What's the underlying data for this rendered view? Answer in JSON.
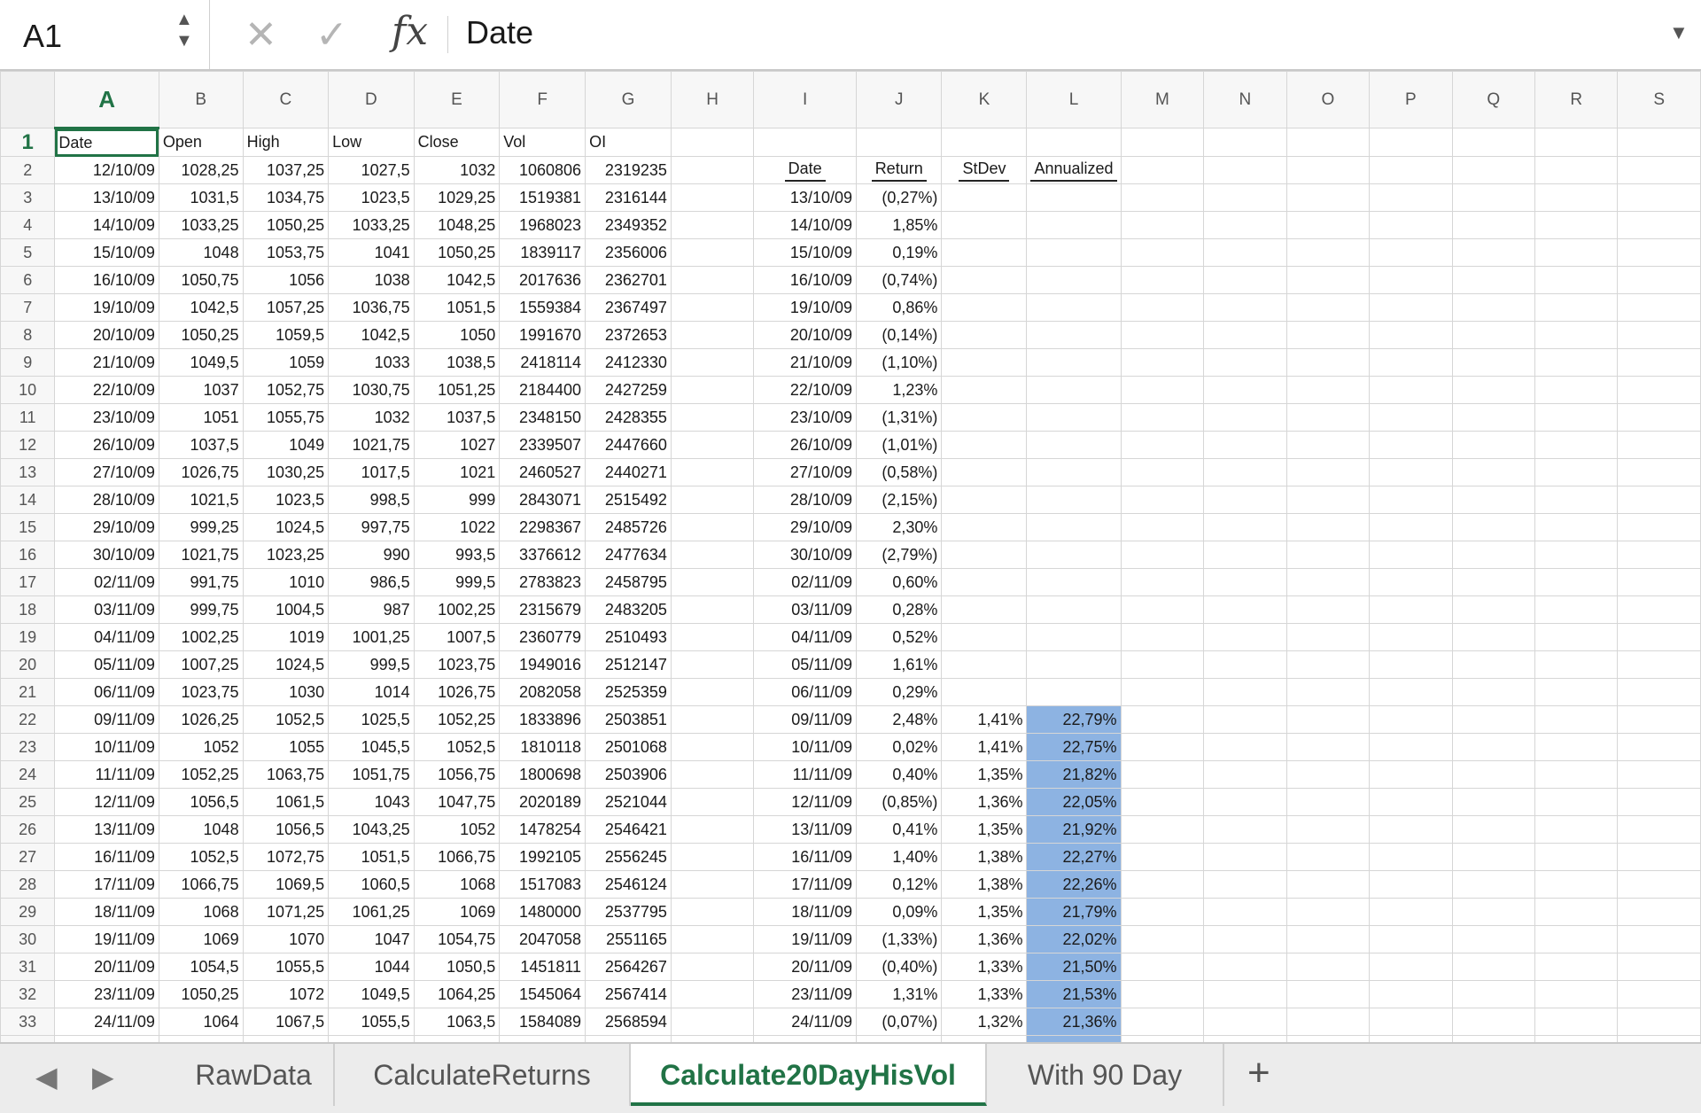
{
  "formula_bar": {
    "name_box": "A1",
    "formula": "Date",
    "cancel_icon": "✕",
    "enter_icon": "✓",
    "fx_label": "fx"
  },
  "columns": [
    "A",
    "B",
    "C",
    "D",
    "E",
    "F",
    "G",
    "H",
    "I",
    "J",
    "K",
    "L",
    "M",
    "N",
    "O",
    "P",
    "Q",
    "R",
    "S"
  ],
  "headers_row1": [
    "Date",
    "Open",
    "High",
    "Low",
    "Close",
    "Vol",
    "OI"
  ],
  "headers_row2": [
    "Date",
    "Return",
    "StDev",
    "Annualized"
  ],
  "rows": [
    {
      "n": "2",
      "d": [
        "12/10/09",
        "1028,25",
        "1037,25",
        "1027,5",
        "1032",
        "1060806",
        "2319235"
      ],
      "r": [
        "",
        "",
        "",
        ""
      ]
    },
    {
      "n": "3",
      "d": [
        "13/10/09",
        "1031,5",
        "1034,75",
        "1023,5",
        "1029,25",
        "1519381",
        "2316144"
      ],
      "r": [
        "13/10/09",
        "(0,27%)",
        "",
        ""
      ]
    },
    {
      "n": "4",
      "d": [
        "14/10/09",
        "1033,25",
        "1050,25",
        "1033,25",
        "1048,25",
        "1968023",
        "2349352"
      ],
      "r": [
        "14/10/09",
        "1,85%",
        "",
        ""
      ]
    },
    {
      "n": "5",
      "d": [
        "15/10/09",
        "1048",
        "1053,75",
        "1041",
        "1050,25",
        "1839117",
        "2356006"
      ],
      "r": [
        "15/10/09",
        "0,19%",
        "",
        ""
      ]
    },
    {
      "n": "6",
      "d": [
        "16/10/09",
        "1050,75",
        "1056",
        "1038",
        "1042,5",
        "2017636",
        "2362701"
      ],
      "r": [
        "16/10/09",
        "(0,74%)",
        "",
        ""
      ]
    },
    {
      "n": "7",
      "d": [
        "19/10/09",
        "1042,5",
        "1057,25",
        "1036,75",
        "1051,5",
        "1559384",
        "2367497"
      ],
      "r": [
        "19/10/09",
        "0,86%",
        "",
        ""
      ]
    },
    {
      "n": "8",
      "d": [
        "20/10/09",
        "1050,25",
        "1059,5",
        "1042,5",
        "1050",
        "1991670",
        "2372653"
      ],
      "r": [
        "20/10/09",
        "(0,14%)",
        "",
        ""
      ]
    },
    {
      "n": "9",
      "d": [
        "21/10/09",
        "1049,5",
        "1059",
        "1033",
        "1038,5",
        "2418114",
        "2412330"
      ],
      "r": [
        "21/10/09",
        "(1,10%)",
        "",
        ""
      ]
    },
    {
      "n": "10",
      "d": [
        "22/10/09",
        "1037",
        "1052,75",
        "1030,75",
        "1051,25",
        "2184400",
        "2427259"
      ],
      "r": [
        "22/10/09",
        "1,23%",
        "",
        ""
      ]
    },
    {
      "n": "11",
      "d": [
        "23/10/09",
        "1051",
        "1055,75",
        "1032",
        "1037,5",
        "2348150",
        "2428355"
      ],
      "r": [
        "23/10/09",
        "(1,31%)",
        "",
        ""
      ]
    },
    {
      "n": "12",
      "d": [
        "26/10/09",
        "1037,5",
        "1049",
        "1021,75",
        "1027",
        "2339507",
        "2447660"
      ],
      "r": [
        "26/10/09",
        "(1,01%)",
        "",
        ""
      ]
    },
    {
      "n": "13",
      "d": [
        "27/10/09",
        "1026,75",
        "1030,25",
        "1017,5",
        "1021",
        "2460527",
        "2440271"
      ],
      "r": [
        "27/10/09",
        "(0,58%)",
        "",
        ""
      ]
    },
    {
      "n": "14",
      "d": [
        "28/10/09",
        "1021,5",
        "1023,5",
        "998,5",
        "999",
        "2843071",
        "2515492"
      ],
      "r": [
        "28/10/09",
        "(2,15%)",
        "",
        ""
      ]
    },
    {
      "n": "15",
      "d": [
        "29/10/09",
        "999,25",
        "1024,5",
        "997,75",
        "1022",
        "2298367",
        "2485726"
      ],
      "r": [
        "29/10/09",
        "2,30%",
        "",
        ""
      ]
    },
    {
      "n": "16",
      "d": [
        "30/10/09",
        "1021,75",
        "1023,25",
        "990",
        "993,5",
        "3376612",
        "2477634"
      ],
      "r": [
        "30/10/09",
        "(2,79%)",
        "",
        ""
      ]
    },
    {
      "n": "17",
      "d": [
        "02/11/09",
        "991,75",
        "1010",
        "986,5",
        "999,5",
        "2783823",
        "2458795"
      ],
      "r": [
        "02/11/09",
        "0,60%",
        "",
        ""
      ]
    },
    {
      "n": "18",
      "d": [
        "03/11/09",
        "999,75",
        "1004,5",
        "987",
        "1002,25",
        "2315679",
        "2483205"
      ],
      "r": [
        "03/11/09",
        "0,28%",
        "",
        ""
      ]
    },
    {
      "n": "19",
      "d": [
        "04/11/09",
        "1002,25",
        "1019",
        "1001,25",
        "1007,5",
        "2360779",
        "2510493"
      ],
      "r": [
        "04/11/09",
        "0,52%",
        "",
        ""
      ]
    },
    {
      "n": "20",
      "d": [
        "05/11/09",
        "1007,25",
        "1024,5",
        "999,5",
        "1023,75",
        "1949016",
        "2512147"
      ],
      "r": [
        "05/11/09",
        "1,61%",
        "",
        ""
      ]
    },
    {
      "n": "21",
      "d": [
        "06/11/09",
        "1023,75",
        "1030",
        "1014",
        "1026,75",
        "2082058",
        "2525359"
      ],
      "r": [
        "06/11/09",
        "0,29%",
        "",
        ""
      ]
    },
    {
      "n": "22",
      "d": [
        "09/11/09",
        "1026,25",
        "1052,5",
        "1025,5",
        "1052,25",
        "1833896",
        "2503851"
      ],
      "r": [
        "09/11/09",
        "2,48%",
        "1,41%",
        "22,79%"
      ]
    },
    {
      "n": "23",
      "d": [
        "10/11/09",
        "1052",
        "1055",
        "1045,5",
        "1052,5",
        "1810118",
        "2501068"
      ],
      "r": [
        "10/11/09",
        "0,02%",
        "1,41%",
        "22,75%"
      ]
    },
    {
      "n": "24",
      "d": [
        "11/11/09",
        "1052,25",
        "1063,75",
        "1051,75",
        "1056,75",
        "1800698",
        "2503906"
      ],
      "r": [
        "11/11/09",
        "0,40%",
        "1,35%",
        "21,82%"
      ]
    },
    {
      "n": "25",
      "d": [
        "12/11/09",
        "1056,5",
        "1061,5",
        "1043",
        "1047,75",
        "2020189",
        "2521044"
      ],
      "r": [
        "12/11/09",
        "(0,85%)",
        "1,36%",
        "22,05%"
      ]
    },
    {
      "n": "26",
      "d": [
        "13/11/09",
        "1048",
        "1056,5",
        "1043,25",
        "1052",
        "1478254",
        "2546421"
      ],
      "r": [
        "13/11/09",
        "0,41%",
        "1,35%",
        "21,92%"
      ]
    },
    {
      "n": "27",
      "d": [
        "16/11/09",
        "1052,5",
        "1072,75",
        "1051,5",
        "1066,75",
        "1992105",
        "2556245"
      ],
      "r": [
        "16/11/09",
        "1,40%",
        "1,38%",
        "22,27%"
      ]
    },
    {
      "n": "28",
      "d": [
        "17/11/09",
        "1066,75",
        "1069,5",
        "1060,5",
        "1068",
        "1517083",
        "2546124"
      ],
      "r": [
        "17/11/09",
        "0,12%",
        "1,38%",
        "22,26%"
      ]
    },
    {
      "n": "29",
      "d": [
        "18/11/09",
        "1068",
        "1071,25",
        "1061,25",
        "1069",
        "1480000",
        "2537795"
      ],
      "r": [
        "18/11/09",
        "0,09%",
        "1,35%",
        "21,79%"
      ]
    },
    {
      "n": "30",
      "d": [
        "19/11/09",
        "1069",
        "1070",
        "1047",
        "1054,75",
        "2047058",
        "2551165"
      ],
      "r": [
        "19/11/09",
        "(1,33%)",
        "1,36%",
        "22,02%"
      ]
    },
    {
      "n": "31",
      "d": [
        "20/11/09",
        "1054,5",
        "1055,5",
        "1044",
        "1050,5",
        "1451811",
        "2564267"
      ],
      "r": [
        "20/11/09",
        "(0,40%)",
        "1,33%",
        "21,50%"
      ]
    },
    {
      "n": "32",
      "d": [
        "23/11/09",
        "1050,25",
        "1072",
        "1049,5",
        "1064,25",
        "1545064",
        "2567414"
      ],
      "r": [
        "23/11/09",
        "1,31%",
        "1,33%",
        "21,53%"
      ]
    },
    {
      "n": "33",
      "d": [
        "24/11/09",
        "1064",
        "1067,5",
        "1055,5",
        "1063,5",
        "1584089",
        "2568594"
      ],
      "r": [
        "24/11/09",
        "(0,07%)",
        "1,32%",
        "21,36%"
      ]
    }
  ],
  "sheet_tabs": [
    "RawData",
    "CalculateReturns",
    "Calculate20DayHisVol",
    "With 90 Day"
  ],
  "active_tab": "Calculate20DayHisVol",
  "add_tab_label": "+",
  "colors": {
    "accent": "#217346",
    "highlight": "#8db3e2"
  }
}
